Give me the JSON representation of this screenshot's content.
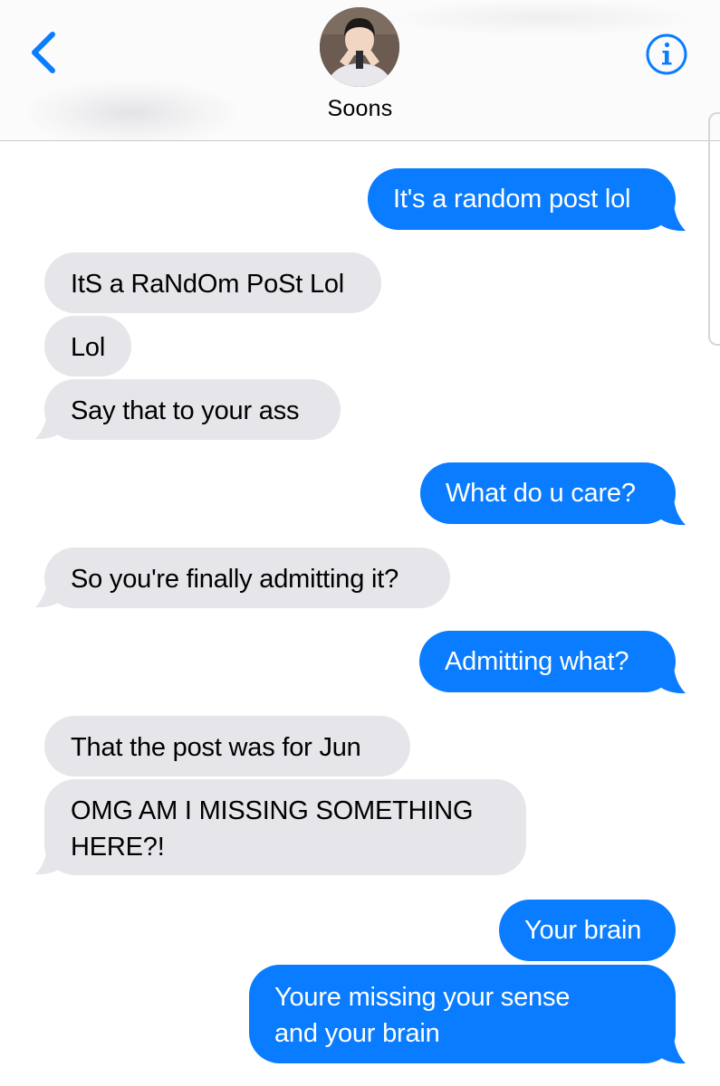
{
  "header": {
    "contact_name": "Soons",
    "back_icon": "chevron-left-icon",
    "info_icon": "info-icon",
    "accent_color": "#0a7cff"
  },
  "messages": [
    {
      "from": "me",
      "text": "It's a random post lol"
    },
    {
      "from": "them",
      "text": "ItS a RaNdOm PoSt Lol"
    },
    {
      "from": "them",
      "text": "Lol"
    },
    {
      "from": "them",
      "text": "Say that to your ass"
    },
    {
      "from": "me",
      "text": "What do u care?"
    },
    {
      "from": "them",
      "text": "So you're finally admitting it?"
    },
    {
      "from": "me",
      "text": "Admitting what?"
    },
    {
      "from": "them",
      "text": "That the post was for Jun"
    },
    {
      "from": "them",
      "line1": "OMG AM I MISSING SOMETHING",
      "line2": "HERE?!"
    },
    {
      "from": "me",
      "text": "Your brain"
    },
    {
      "from": "me",
      "line1": "Youre missing your sense",
      "line2": "and your brain"
    }
  ],
  "colors": {
    "sent_bubble": "#0a7cff",
    "received_bubble": "#e5e5ea"
  }
}
